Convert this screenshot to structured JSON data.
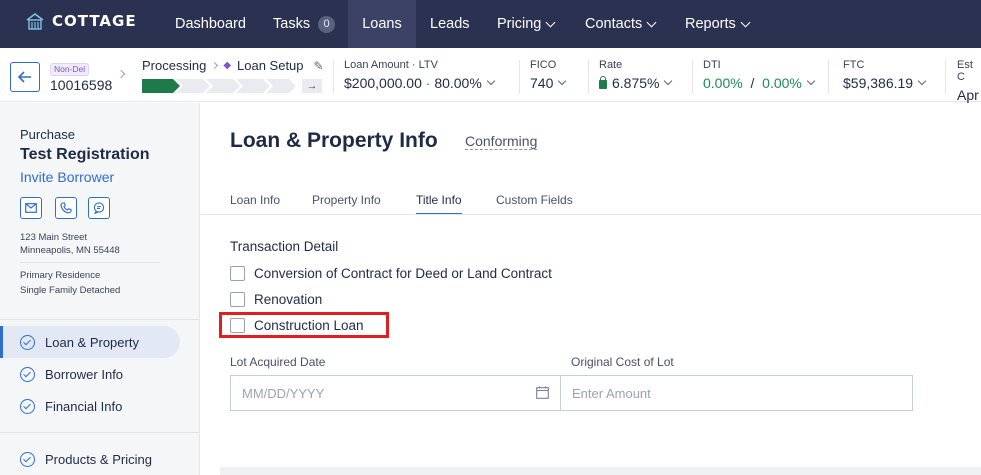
{
  "nav": {
    "logo": "COTTAGE",
    "items": [
      {
        "label": "Dashboard"
      },
      {
        "label": "Tasks",
        "badge": "0"
      },
      {
        "label": "Loans"
      },
      {
        "label": "Leads"
      },
      {
        "label": "Pricing"
      },
      {
        "label": "Contacts"
      },
      {
        "label": "Reports"
      }
    ]
  },
  "loan": {
    "tag": "Non-Del",
    "number": "10016598",
    "stage": "Processing",
    "substage": "Loan Setup"
  },
  "metrics": {
    "amount_ltv": {
      "label": "Loan Amount · LTV",
      "value1": "$200,000.00",
      "dot": "·",
      "value2": "80.00%"
    },
    "fico": {
      "label": "FICO",
      "value": "740"
    },
    "rate": {
      "label": "Rate",
      "value": "6.875%"
    },
    "dti": {
      "label": "DTI",
      "value1": "0.00%",
      "slash": "/",
      "value2": "0.00%"
    },
    "ftc": {
      "label": "FTC",
      "value": "$59,386.19"
    },
    "est": {
      "label": "Est C",
      "value": "Apr"
    }
  },
  "sidebar": {
    "loan_purpose": "Purchase",
    "borrower_name": "Test Registration",
    "invite": "Invite Borrower",
    "address_line1": "123 Main Street",
    "address_line2": "Minneapolis, MN 55448",
    "occupancy": "Primary Residence",
    "property_type": "Single Family Detached",
    "steps": [
      {
        "label": "Loan & Property"
      },
      {
        "label": "Borrower Info"
      },
      {
        "label": "Financial Info"
      },
      {
        "label": "Products & Pricing"
      }
    ]
  },
  "main": {
    "title": "Loan & Property Info",
    "loan_type": "Conforming",
    "tabs": [
      {
        "label": "Loan Info"
      },
      {
        "label": "Property Info"
      },
      {
        "label": "Title Info"
      },
      {
        "label": "Custom Fields"
      }
    ],
    "section_title": "Transaction Detail",
    "checkboxes": [
      {
        "label": "Conversion of Contract for Deed or Land Contract",
        "checked": false
      },
      {
        "label": "Renovation",
        "checked": false
      },
      {
        "label": "Construction Loan",
        "checked": false
      }
    ],
    "lot_acquired_label": "Lot Acquired Date",
    "lot_acquired_placeholder": "MM/DD/YYYY",
    "original_cost_label": "Original Cost of Lot",
    "original_cost_placeholder": "Enter Amount"
  },
  "colors": {
    "nav_bg": "#2b3150",
    "accent": "#2f6dd0",
    "progress_done": "#1e7a4a",
    "highlight": "#e02020"
  }
}
